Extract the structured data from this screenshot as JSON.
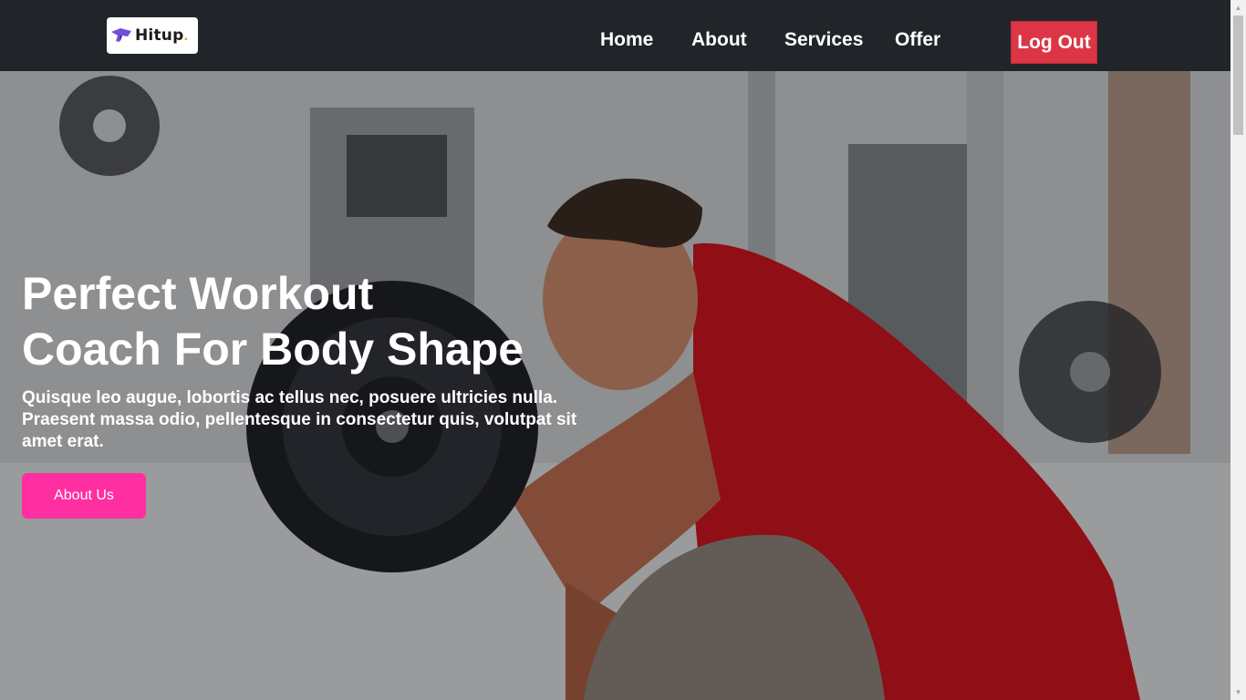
{
  "brand": {
    "name": "Hitup",
    "dot": "."
  },
  "nav": {
    "items": [
      {
        "label": "Home"
      },
      {
        "label": "About"
      },
      {
        "label": "Services"
      },
      {
        "label": "Offer"
      }
    ],
    "logout_label": "Log Out"
  },
  "hero": {
    "title_line1": "Perfect Workout",
    "title_line2": "Coach For Body Shape",
    "description": "Quisque leo augue, lobortis ac tellus nec, posuere ultricies nulla. Praesent massa odio, pellentesque in consectetur quis, volutpat sit amet erat.",
    "cta_label": "About Us"
  },
  "colors": {
    "navbar_bg": "#212529",
    "logout_bg": "#dc3545",
    "cta_bg": "#ff2fa2",
    "shirt_red": "#c8141e"
  }
}
